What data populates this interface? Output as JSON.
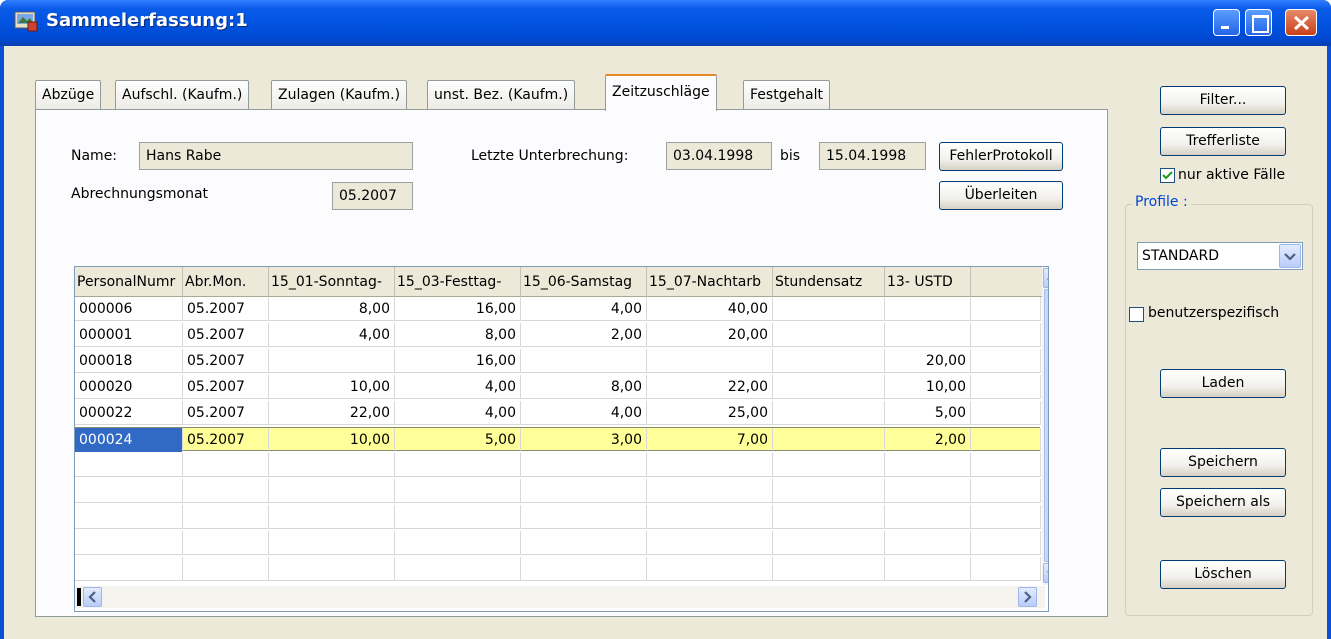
{
  "window": {
    "title": "Sammelerfassung:1"
  },
  "tabs": [
    {
      "label": "Abzüge",
      "active": false
    },
    {
      "label": "Aufschl. (Kaufm.)",
      "active": false
    },
    {
      "label": "Zulagen (Kaufm.)",
      "active": false
    },
    {
      "label": "unst. Bez. (Kaufm.)",
      "active": false
    },
    {
      "label": "Zeitzuschläge",
      "active": true
    },
    {
      "label": "Festgehalt",
      "active": false
    }
  ],
  "form": {
    "name_label": "Name:",
    "name_value": "Hans Rabe",
    "unterbrechung_label": "Letzte Unterbrechung:",
    "von_value": "03.04.1998",
    "bis_label": "bis",
    "bis_value": "15.04.1998",
    "monat_label": "Abrechnungsmonat",
    "monat_value": "05.2007",
    "fehler_button": "FehlerProtokoll",
    "ueberleiten_button": "Überleiten"
  },
  "grid": {
    "columns": [
      "PersonalNumr",
      "Abr.Mon.",
      "15_01-Sonntag-",
      "15_03-Festtag-",
      "15_06-Samstag",
      "15_07-Nachtarb",
      "Stundensatz",
      "13-  USTD"
    ],
    "rows": [
      [
        "000006",
        "05.2007",
        "8,00",
        "16,00",
        "4,00",
        "40,00",
        "",
        ""
      ],
      [
        "000001",
        "05.2007",
        "4,00",
        "8,00",
        "2,00",
        "20,00",
        "",
        ""
      ],
      [
        "000018",
        "05.2007",
        "",
        "16,00",
        "",
        "",
        "",
        "20,00"
      ],
      [
        "000020",
        "05.2007",
        "10,00",
        "4,00",
        "8,00",
        "22,00",
        "",
        "10,00"
      ],
      [
        "000022",
        "05.2007",
        "22,00",
        "4,00",
        "4,00",
        "25,00",
        "",
        "5,00"
      ],
      [
        "000024",
        "05.2007",
        "10,00",
        "5,00",
        "3,00",
        "7,00",
        "",
        "2,00"
      ]
    ],
    "selected_row": 5
  },
  "sidebar": {
    "filter_button": "Filter...",
    "trefferliste_button": "Trefferliste",
    "nur_aktive_label": "nur aktive Fälle",
    "nur_aktive_checked": true,
    "profile_title": "Profile :",
    "profile_selected": "STANDARD",
    "benutzer_label": "benutzerspezifisch",
    "benutzer_checked": false,
    "laden_button": "Laden",
    "speichern_button": "Speichern",
    "speichern_als_button": "Speichern als",
    "loeschen_button": "Löschen"
  },
  "colors": {
    "titlebar": "#0052df",
    "selected_row": "#ffff9a",
    "selected_cell": "#316ac5",
    "profile_title": "#0046d5"
  }
}
